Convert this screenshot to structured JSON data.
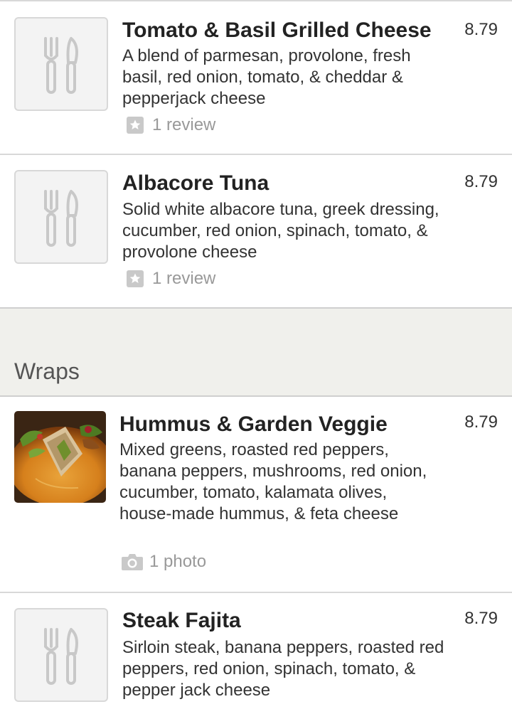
{
  "sections": [
    {
      "items": [
        {
          "name": "Tomato & Basil Grilled Cheese",
          "description": "A blend of parmesan, provolone, fresh basil, red onion, tomato, & cheddar & pepperjack cheese",
          "price": "8.79",
          "meta": "1 review",
          "meta_icon": "star-icon",
          "thumbnail": "fork-knife-icon"
        },
        {
          "name": "Albacore Tuna",
          "description": "Solid white albacore tuna, greek dressing, cucumber, red onion, spinach, tomato, & provolone cheese",
          "price": "8.79",
          "meta": "1 review",
          "meta_icon": "star-icon",
          "thumbnail": "fork-knife-icon"
        }
      ]
    },
    {
      "title": "Wraps",
      "items": [
        {
          "name": "Hummus & Garden Veggie",
          "description": "Mixed greens, roasted red peppers, banana peppers, mushrooms, red onion, cucumber, tomato, kalamata olives, house-made hummus, & feta cheese",
          "price": "8.79",
          "meta": "1 photo",
          "meta_icon": "camera-icon",
          "thumbnail": "food-photo"
        },
        {
          "name": "Steak Fajita",
          "description": "Sirloin steak, banana peppers, roasted red peppers, red onion, spinach, tomato, & pepper jack cheese",
          "price": "8.79",
          "thumbnail": "fork-knife-icon"
        }
      ]
    }
  ]
}
